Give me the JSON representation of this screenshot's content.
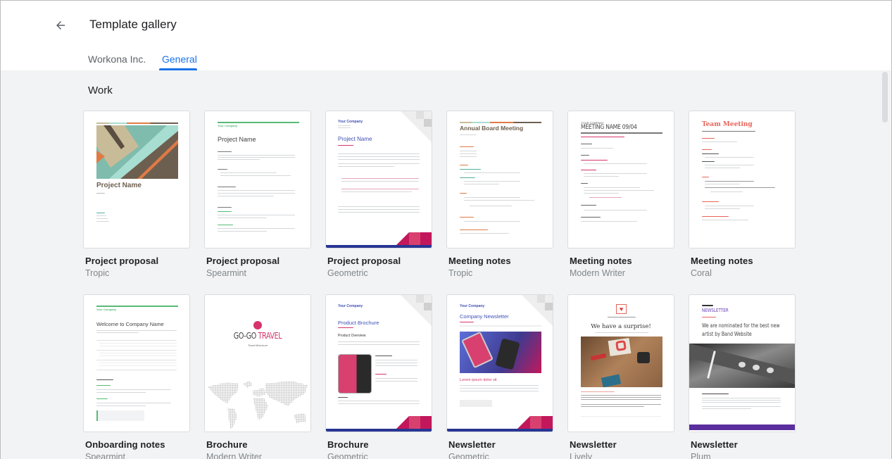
{
  "header": {
    "title": "Template gallery",
    "back_icon": "arrow-back-icon",
    "tabs": [
      {
        "label": "Workona Inc.",
        "active": false
      },
      {
        "label": "General",
        "active": true
      }
    ]
  },
  "colors": {
    "accent": "#1a73e8",
    "background": "#f1f3f4"
  },
  "section": {
    "title": "Work",
    "templates": [
      {
        "name": "Project proposal",
        "style": "Tropic",
        "thumb_title": "Project Name"
      },
      {
        "name": "Project proposal",
        "style": "Spearmint",
        "thumb_title": "Project Name",
        "thumb_company": "Your Company"
      },
      {
        "name": "Project proposal",
        "style": "Geometric",
        "thumb_title": "Project Name",
        "thumb_company": "Your Company"
      },
      {
        "name": "Meeting notes",
        "style": "Tropic",
        "thumb_title": "Annual Board Meeting"
      },
      {
        "name": "Meeting notes",
        "style": "Modern Writer",
        "thumb_title": "MEETING NAME 09/04",
        "thumb_company": "YOUR COMPANY"
      },
      {
        "name": "Meeting notes",
        "style": "Coral",
        "thumb_title": "Team Meeting"
      },
      {
        "name": "Onboarding notes",
        "style": "Spearmint",
        "thumb_title": "Welcome to Company Name",
        "thumb_company": "Your Company"
      },
      {
        "name": "Brochure",
        "style": "Modern Writer",
        "thumb_title_a": "GO-GO",
        "thumb_title_b": "TRAVEL",
        "thumb_sub": "Travel Brochure"
      },
      {
        "name": "Brochure",
        "style": "Geometric",
        "thumb_title": "Product Brochure",
        "thumb_company": "Your Company",
        "thumb_heading": "Product Overview"
      },
      {
        "name": "Newsletter",
        "style": "Geometric",
        "thumb_title": "Company Newsletter",
        "thumb_company": "Your Company",
        "thumb_heading": "Lorem ipsum dolor sit"
      },
      {
        "name": "Newsletter",
        "style": "Lively",
        "thumb_title": "We have a surprise!"
      },
      {
        "name": "Newsletter",
        "style": "Plum",
        "thumb_title": "NEWSLETTER",
        "thumb_heading": "We are nominated for the best new artist by Band Website"
      }
    ]
  }
}
